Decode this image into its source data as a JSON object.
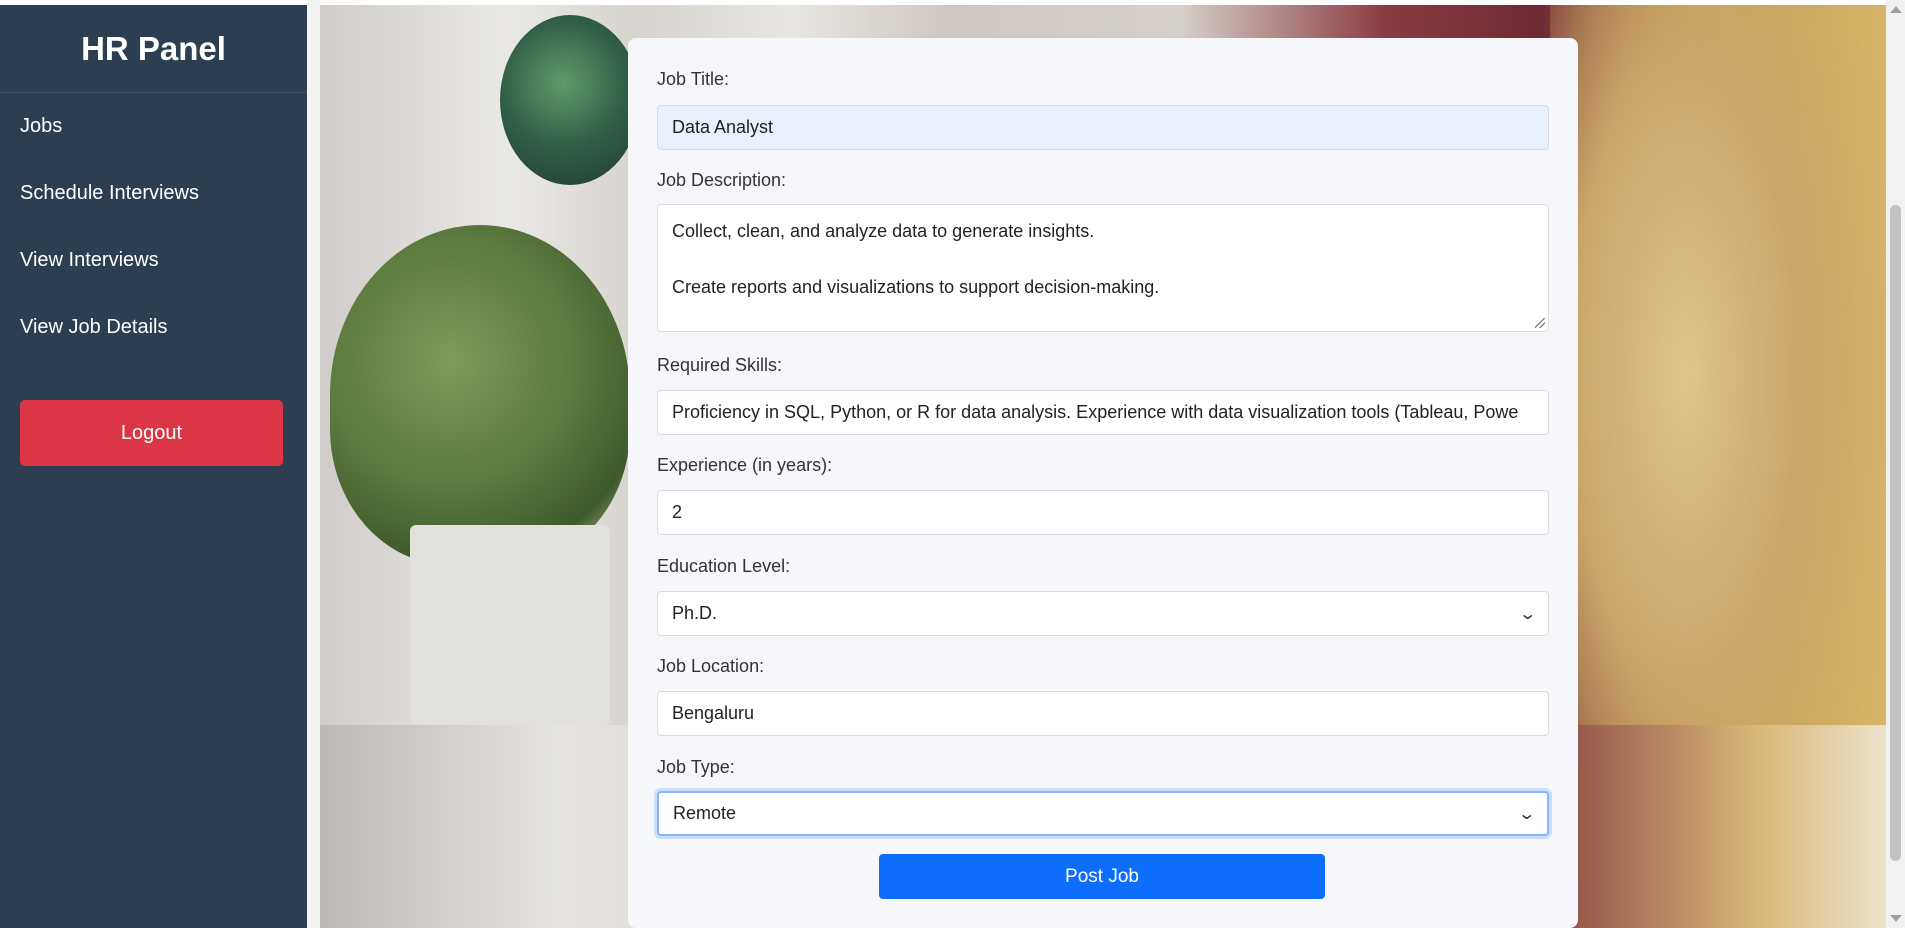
{
  "sidebar": {
    "title": "HR Panel",
    "items": [
      {
        "label": "Jobs"
      },
      {
        "label": "Schedule Interviews"
      },
      {
        "label": "View Interviews"
      },
      {
        "label": "View Job Details"
      }
    ],
    "logout_label": "Logout"
  },
  "form": {
    "job_title": {
      "label": "Job Title:",
      "value": "Data Analyst"
    },
    "job_description": {
      "label": "Job Description:",
      "lines": [
        "Collect, clean, and analyze data to generate insights.",
        "",
        "Create reports and visualizations to support decision-making."
      ]
    },
    "required_skills": {
      "label": "Required Skills:",
      "value": "Proficiency in SQL, Python, or R for data analysis.  Experience with data visualization tools (Tableau, Powe"
    },
    "experience": {
      "label": "Experience (in years):",
      "value": "2"
    },
    "education_level": {
      "label": "Education Level:",
      "value": "Ph.D."
    },
    "job_location": {
      "label": "Job Location:",
      "value": "Bengaluru"
    },
    "job_type": {
      "label": "Job Type:",
      "value": "Remote"
    },
    "submit_label": "Post Job"
  },
  "colors": {
    "sidebar_bg": "#2c3e50",
    "logout": "#dc3545",
    "primary": "#0d6efd",
    "panel_bg": "#f5f7fa"
  },
  "icons": {
    "select_chevron": "chevron-down-icon"
  }
}
